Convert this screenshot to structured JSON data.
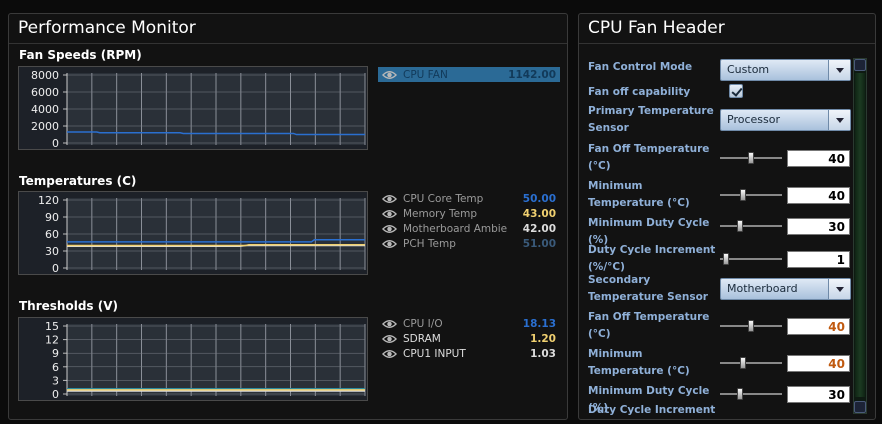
{
  "perf": {
    "title": "Performance Monitor",
    "fan_section": {
      "title": "Fan Speeds (RPM)",
      "y_ticks": [
        "8000",
        "6000",
        "4000",
        "2000",
        "0"
      ],
      "legend": [
        {
          "name": "CPU FAN",
          "value": "1142.00",
          "name_color": "#123a5a",
          "value_color": "#123a5a",
          "selected": true
        }
      ]
    },
    "temp_section": {
      "title": "Temperatures (C)",
      "y_ticks": [
        "120",
        "90",
        "60",
        "30",
        "0"
      ],
      "legend": [
        {
          "name": "CPU Core Temp",
          "value": "50.00",
          "name_color": "#9a9a9a",
          "value_color": "#2a6fd0"
        },
        {
          "name": "Memory Temp",
          "value": "43.00",
          "name_color": "#9a9a9a",
          "value_color": "#f0d070"
        },
        {
          "name": "Motherboard Ambient",
          "value": "42.00",
          "name_color": "#9a9a9a",
          "value_color": "#dddddd"
        },
        {
          "name": "PCH Temp",
          "value": "51.00",
          "name_color": "#9a9a9a",
          "value_color": "#3a5a7a"
        }
      ]
    },
    "volt_section": {
      "title": "Thresholds (V)",
      "y_ticks": [
        "15",
        "12",
        "9",
        "6",
        "3",
        "0"
      ],
      "legend": [
        {
          "name": "CPU I/O",
          "value": "18.13",
          "name_color": "#9a9a9a",
          "value_color": "#2a6fd0"
        },
        {
          "name": "SDRAM",
          "value": "1.20",
          "name_color": "#dddddd",
          "value_color": "#f0d070"
        },
        {
          "name": "CPU1 INPUT",
          "value": "1.03",
          "name_color": "#dddddd",
          "value_color": "#dddddd"
        }
      ]
    }
  },
  "fan_header": {
    "title": "CPU Fan Header",
    "rows": [
      {
        "label": "Fan Control Mode",
        "type": "dropdown",
        "value": "Custom"
      },
      {
        "label": "Fan off capability",
        "type": "checkbox",
        "checked": true
      },
      {
        "label": "Primary Temperature Sensor",
        "type": "dropdown",
        "value": "Processor"
      },
      {
        "label": "Fan Off Temperature (°C)",
        "type": "slider",
        "value": "40",
        "slider_level": 0.5,
        "value_color": "#000000"
      },
      {
        "label": "Minimum Temperature (°C)",
        "type": "slider",
        "value": "40",
        "slider_level": 0.35,
        "value_color": "#000000"
      },
      {
        "label": "Minimum Duty Cycle (%)",
        "type": "slider",
        "value": "30",
        "slider_level": 0.3,
        "value_color": "#000000"
      },
      {
        "label": "Duty Cycle Increment (%/°C)",
        "type": "slider",
        "value": "1",
        "slider_level": 0.05,
        "value_color": "#000000"
      },
      {
        "label": "Secondary Temperature Sensor",
        "type": "dropdown",
        "value": "Motherboard"
      },
      {
        "label": "Fan Off Temperature (°C)",
        "type": "slider",
        "value": "40",
        "slider_level": 0.5,
        "value_color": "#c05a10"
      },
      {
        "label": "Minimum Temperature (°C)",
        "type": "slider",
        "value": "40",
        "slider_level": 0.35,
        "value_color": "#c05a10"
      },
      {
        "label": "Minimum Duty Cycle (%)",
        "type": "slider",
        "value": "30",
        "slider_level": 0.3,
        "value_color": "#000000"
      },
      {
        "label": "Duty Cycle Increment",
        "type": "label_only"
      }
    ]
  }
}
